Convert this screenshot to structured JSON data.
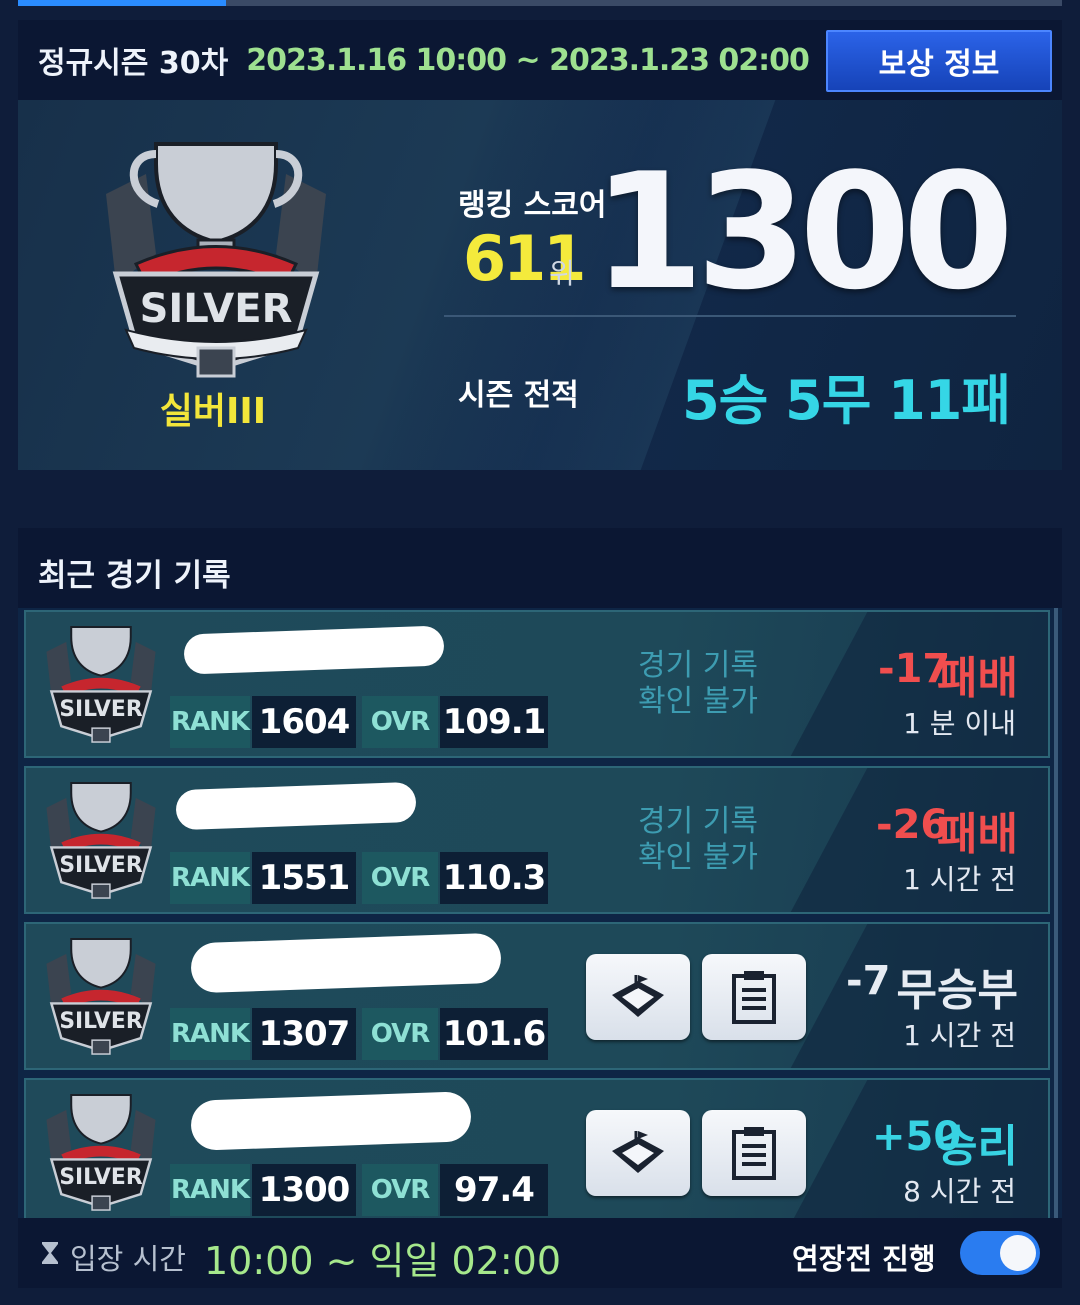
{
  "season": {
    "title": "정규시즌 30차",
    "dates": "2023.1.16 10:00 ~ 2023.1.23 02:00",
    "reward_button": "보상 정보",
    "tier": "실버III",
    "emblem_text": "SILVER",
    "rank_label": "랭킹 스코어",
    "rank": "611",
    "rank_unit": "위",
    "score": "1300",
    "record_label": "시즌 전적",
    "record": "5승 5무 11패"
  },
  "recent": {
    "title": "최근 경기 기록",
    "rank_label": "RANK",
    "ovr_label": "OVR",
    "matches": [
      {
        "rank": "1604",
        "ovr": "109.1",
        "note": "경기 기록\n확인 불가",
        "delta": "-17",
        "result": "패배",
        "time": "1 분 이내",
        "type": "loss"
      },
      {
        "rank": "1551",
        "ovr": "110.3",
        "note": "경기 기록\n확인 불가",
        "delta": "-26",
        "result": "패배",
        "time": "1 시간 전",
        "type": "loss"
      },
      {
        "rank": "1307",
        "ovr": "101.6",
        "delta": "-7",
        "result": "무승부",
        "time": "1 시간 전",
        "type": "draw"
      },
      {
        "rank": "1300",
        "ovr": "97.4",
        "delta": "+50",
        "result": "승리",
        "time": "8 시간 전",
        "type": "win"
      }
    ]
  },
  "footer": {
    "entry_label": "입장 시간",
    "entry_time": "10:00 ~ 익일 02:00",
    "overtime_label": "연장전 진행",
    "overtime_enabled": true
  },
  "colors": {
    "accent": "#2a7cf0",
    "loss": "#f04e4e",
    "win": "#38d3e3",
    "rank_yellow": "#f4ea3c"
  }
}
